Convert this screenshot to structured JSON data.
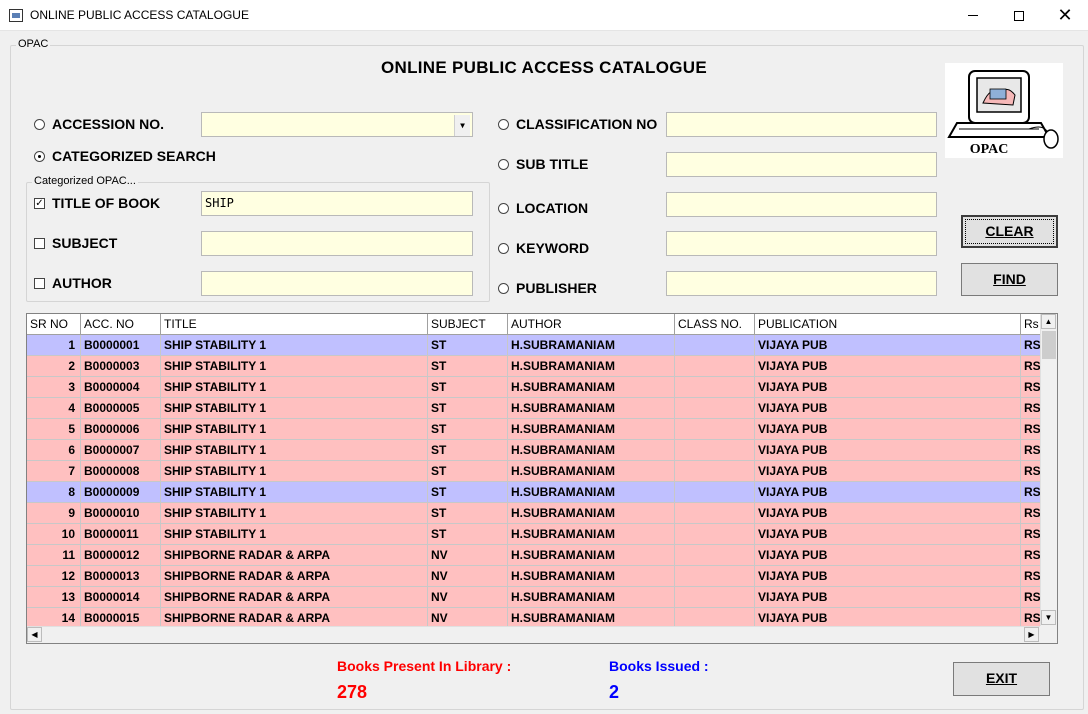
{
  "window": {
    "title": "ONLINE PUBLIC ACCESS CATALOGUE"
  },
  "frame_label": "OPAC",
  "heading": "ONLINE PUBLIC ACCESS CATALOGUE",
  "logo_text": "OPAC",
  "search": {
    "accession_label": "ACCESSION NO.",
    "accession_value": "",
    "categorized_label": "CATEGORIZED SEARCH",
    "categorized_group_label": "Categorized OPAC...",
    "title_label": "TITLE OF BOOK",
    "title_value": "SHIP",
    "subject_label": "SUBJECT",
    "subject_value": "",
    "author_label": "AUTHOR",
    "author_value": "",
    "classification_label": "CLASSIFICATION NO",
    "classification_value": "",
    "subtitle_label": "SUB TITLE",
    "subtitle_value": "",
    "location_label": "LOCATION",
    "location_value": "",
    "keyword_label": "KEYWORD",
    "keyword_value": "",
    "publisher_label": "PUBLISHER",
    "publisher_value": ""
  },
  "buttons": {
    "clear": "CLEAR",
    "find": "FIND",
    "exit": "EXIT"
  },
  "grid": {
    "columns": [
      "SR NO",
      "ACC. NO",
      "TITLE",
      "SUBJECT",
      "AUTHOR",
      "CLASS NO.",
      "PUBLICATION",
      "Rs"
    ],
    "rows": [
      {
        "sr": "1",
        "acc": "B0000001",
        "title": "SHIP STABILITY  1",
        "subject": "ST",
        "author": "H.SUBRAMANIAM",
        "class": "",
        "pub": "VIJAYA PUB",
        "rs": "RS",
        "hl": "blue"
      },
      {
        "sr": "2",
        "acc": "B0000003",
        "title": "SHIP STABILITY  1",
        "subject": "ST",
        "author": "H.SUBRAMANIAM",
        "class": "",
        "pub": "VIJAYA PUB",
        "rs": "RS",
        "hl": "pink"
      },
      {
        "sr": "3",
        "acc": "B0000004",
        "title": "SHIP STABILITY 1",
        "subject": "ST",
        "author": "H.SUBRAMANIAM",
        "class": "",
        "pub": "VIJAYA PUB",
        "rs": "RS",
        "hl": "pink"
      },
      {
        "sr": "4",
        "acc": "B0000005",
        "title": "SHIP STABILITY  1",
        "subject": "ST",
        "author": "H.SUBRAMANIAM",
        "class": "",
        "pub": "VIJAYA PUB",
        "rs": "RS",
        "hl": "pink"
      },
      {
        "sr": "5",
        "acc": "B0000006",
        "title": "SHIP STABILITY  1",
        "subject": "ST",
        "author": "H.SUBRAMANIAM",
        "class": "",
        "pub": "VIJAYA PUB",
        "rs": "RS",
        "hl": "pink"
      },
      {
        "sr": "6",
        "acc": "B0000007",
        "title": "SHIP  STABILITY 1",
        "subject": "ST",
        "author": "H.SUBRAMANIAM",
        "class": "",
        "pub": "VIJAYA PUB",
        "rs": "RS",
        "hl": "pink"
      },
      {
        "sr": "7",
        "acc": "B0000008",
        "title": "SHIP STABILITY  1",
        "subject": "ST",
        "author": "H.SUBRAMANIAM",
        "class": "",
        "pub": "VIJAYA PUB",
        "rs": "RS",
        "hl": "pink"
      },
      {
        "sr": "8",
        "acc": "B0000009",
        "title": "SHIP STABILITY  1",
        "subject": "ST",
        "author": "H.SUBRAMANIAM",
        "class": "",
        "pub": "VIJAYA PUB",
        "rs": "RS",
        "hl": "blue"
      },
      {
        "sr": "9",
        "acc": "B0000010",
        "title": "SHIP STABILITY  1",
        "subject": "ST",
        "author": "H.SUBRAMANIAM",
        "class": "",
        "pub": "VIJAYA PUB",
        "rs": "RS",
        "hl": "pink"
      },
      {
        "sr": "10",
        "acc": "B0000011",
        "title": "SHIP STABILITY  1",
        "subject": "ST",
        "author": "H.SUBRAMANIAM",
        "class": "",
        "pub": "VIJAYA PUB",
        "rs": "RS",
        "hl": "pink"
      },
      {
        "sr": "11",
        "acc": "B0000012",
        "title": "SHIPBORNE RADAR & ARPA",
        "subject": "NV",
        "author": "H.SUBRAMANIAM",
        "class": "",
        "pub": "VIJAYA PUB",
        "rs": "RS",
        "hl": "pink"
      },
      {
        "sr": "12",
        "acc": "B0000013",
        "title": "SHIPBORNE RADAR & ARPA",
        "subject": "NV",
        "author": "H.SUBRAMANIAM",
        "class": "",
        "pub": "VIJAYA PUB",
        "rs": "RS",
        "hl": "pink"
      },
      {
        "sr": "13",
        "acc": "B0000014",
        "title": "SHIPBORNE RADAR & ARPA",
        "subject": "NV",
        "author": "H.SUBRAMANIAM",
        "class": "",
        "pub": "VIJAYA PUB",
        "rs": "RS",
        "hl": "pink"
      },
      {
        "sr": "14",
        "acc": "B0000015",
        "title": "SHIPBORNE RADAR & ARPA",
        "subject": "NV",
        "author": "H.SUBRAMANIAM",
        "class": "",
        "pub": "VIJAYA PUB",
        "rs": "RS",
        "hl": "pink"
      }
    ]
  },
  "stats": {
    "present_label": "Books Present In Library :",
    "present_value": "278",
    "issued_label": "Books Issued :",
    "issued_value": "2"
  },
  "colors": {
    "row_pink": "#ffc0c0",
    "row_blue": "#c0c0ff",
    "field_bg": "#ffffe1",
    "present": "#ff0000",
    "issued": "#0000ff"
  }
}
